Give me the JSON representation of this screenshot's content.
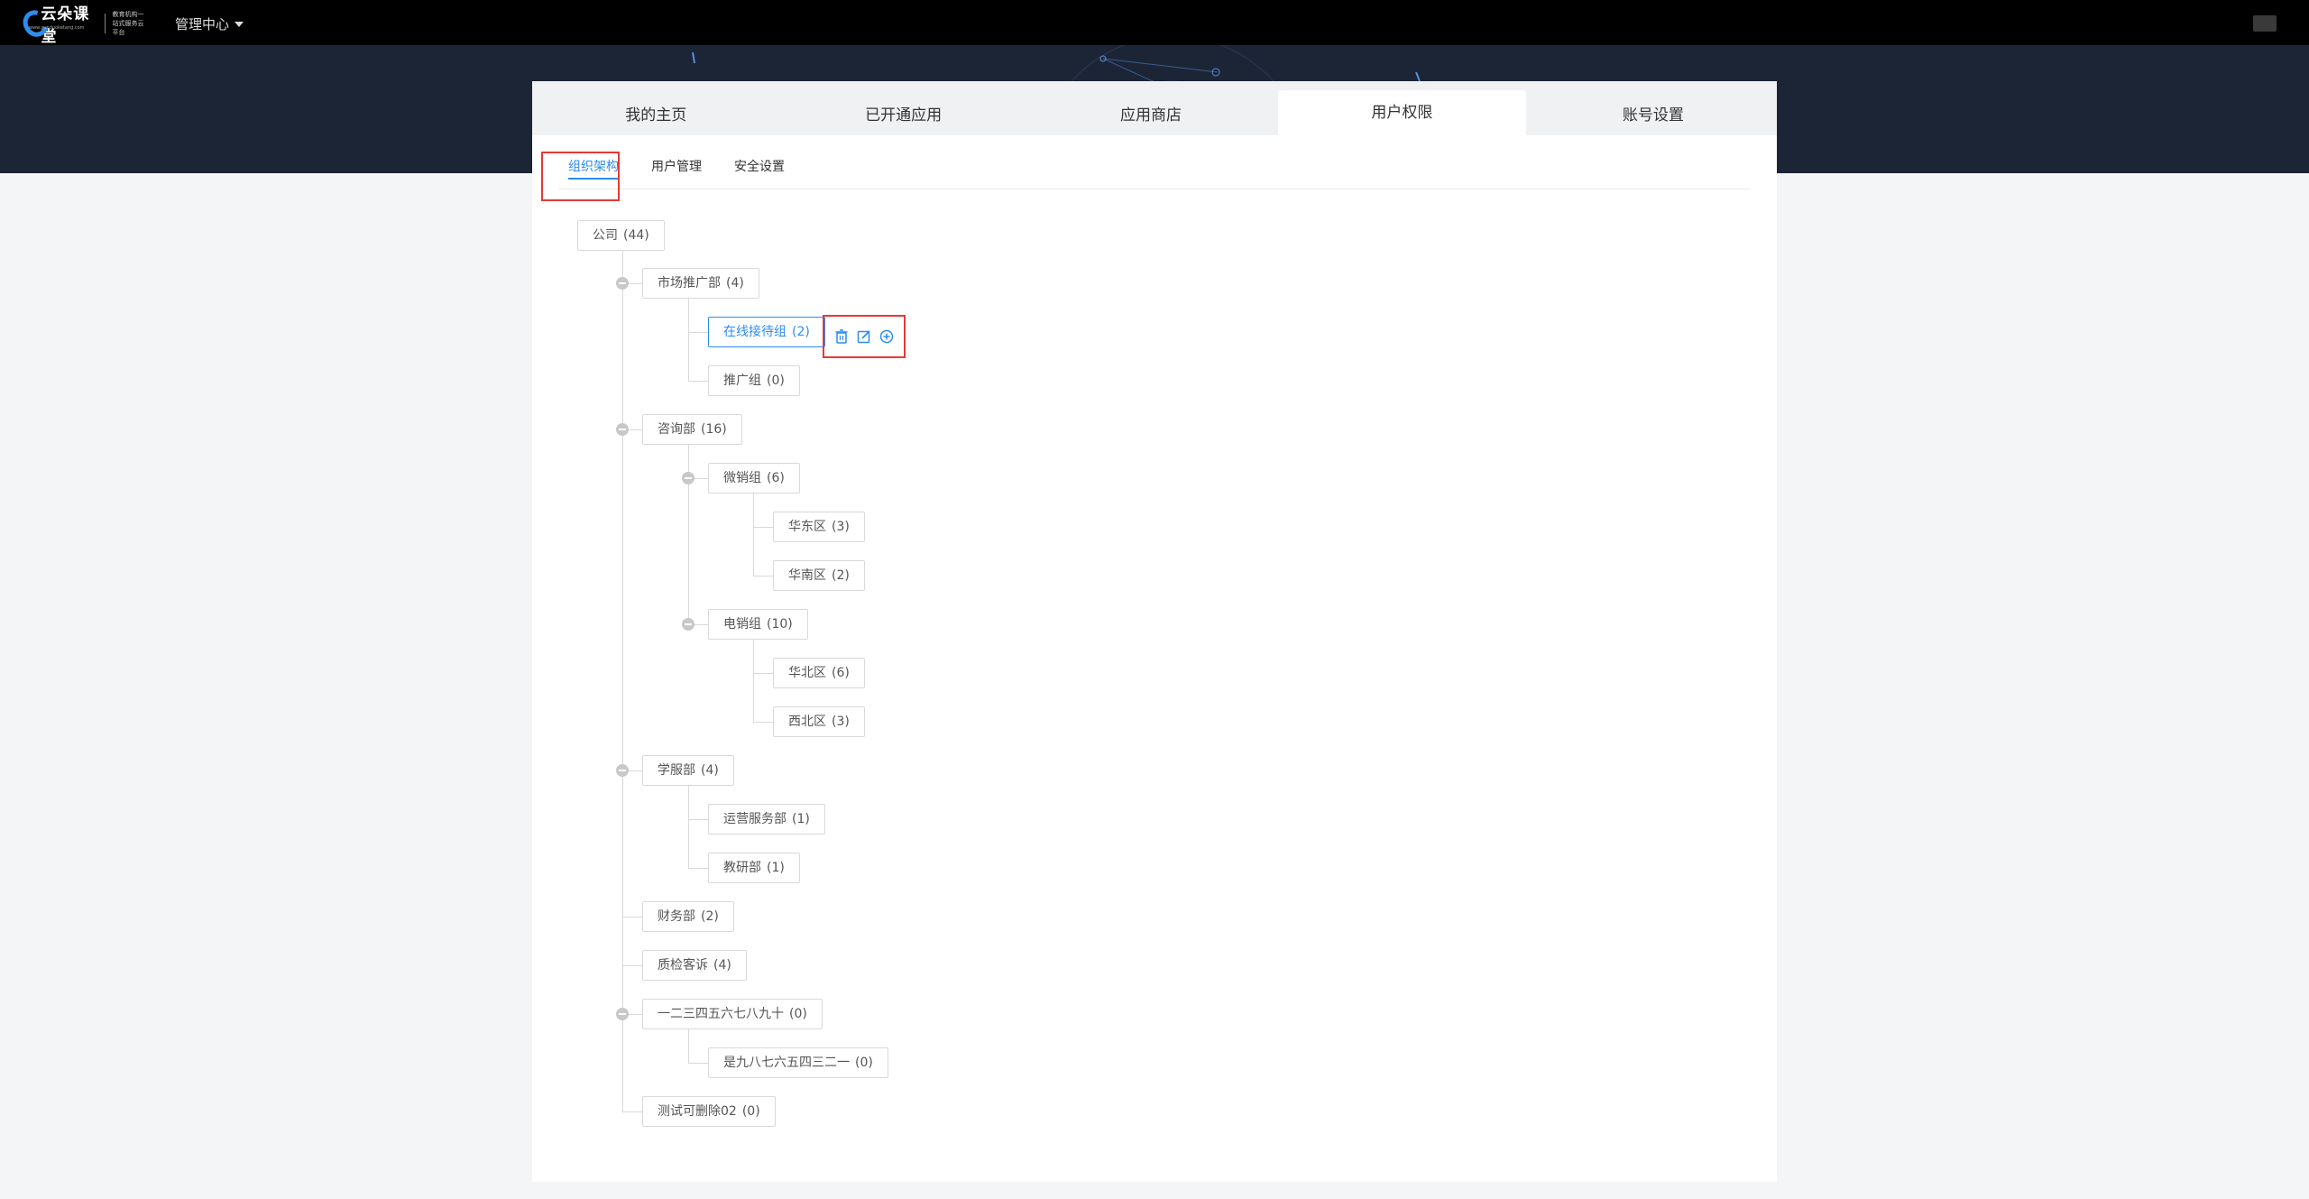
{
  "header": {
    "logo_text": "云朵课堂",
    "logo_slogan": "教育机构一站式服务云平台",
    "logo_url": "www.yunduoketang.com",
    "admin_menu_label": "管理中心"
  },
  "main_tabs": [
    {
      "label": "我的主页"
    },
    {
      "label": "已开通应用"
    },
    {
      "label": "应用商店"
    },
    {
      "label": "用户权限",
      "active": true
    },
    {
      "label": "账号设置"
    }
  ],
  "sub_tabs": [
    {
      "label": "组织架构",
      "active": true
    },
    {
      "label": "用户管理"
    },
    {
      "label": "安全设置"
    }
  ],
  "tree": {
    "root": {
      "label": "公司",
      "count": "(44)"
    },
    "nodes": {
      "market": {
        "label": "市场推广部",
        "count": "(4)"
      },
      "online": {
        "label": "在线接待组",
        "count": "(2)"
      },
      "promo": {
        "label": "推广组",
        "count": "(0)"
      },
      "consult": {
        "label": "咨询部",
        "count": "(16)"
      },
      "wechat": {
        "label": "微销组",
        "count": "(6)"
      },
      "east": {
        "label": "华东区",
        "count": "(3)"
      },
      "south": {
        "label": "华南区",
        "count": "(2)"
      },
      "phone": {
        "label": "电销组",
        "count": "(10)"
      },
      "north": {
        "label": "华北区",
        "count": "(6)"
      },
      "northwest": {
        "label": "西北区",
        "count": "(3)"
      },
      "student": {
        "label": "学服部",
        "count": "(4)"
      },
      "ops": {
        "label": "运营服务部",
        "count": "(1)"
      },
      "research": {
        "label": "教研部",
        "count": "(1)"
      },
      "finance": {
        "label": "财务部",
        "count": "(2)"
      },
      "qa": {
        "label": "质检客诉",
        "count": "(4)"
      },
      "numbers": {
        "label": "一二三四五六七八九十",
        "count": "(0)"
      },
      "numbers_rev": {
        "label": "是九八七六五四三二一",
        "count": "(0)"
      },
      "deletable": {
        "label": "测试可删除02",
        "count": "(0)"
      }
    }
  },
  "colors": {
    "accent": "#2d8cf0",
    "highlight": "#e53935",
    "topbar": "#000000",
    "banner": "#1c2536"
  }
}
